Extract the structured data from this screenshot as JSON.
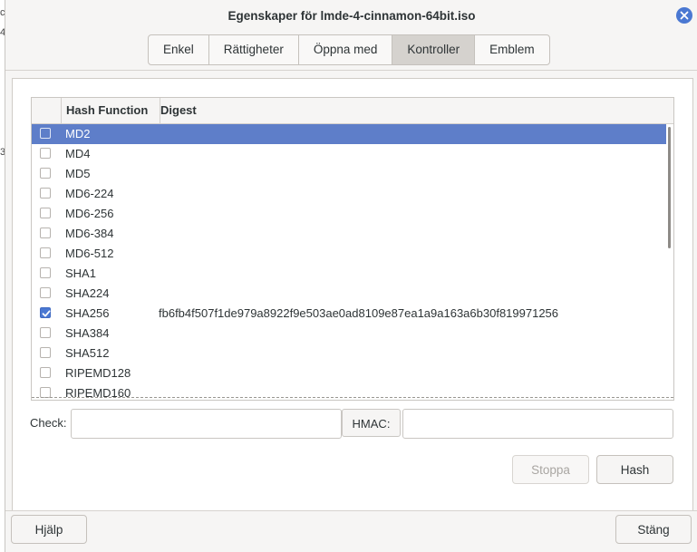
{
  "window": {
    "title": "Egenskaper för lmde-4-cinnamon-64bit.iso",
    "close_icon": "close-icon"
  },
  "background_fragments": [
    "cc",
    "4",
    "3"
  ],
  "tabs": [
    {
      "label": "Enkel",
      "active": false
    },
    {
      "label": "Rättigheter",
      "active": false
    },
    {
      "label": "Öppna med",
      "active": false
    },
    {
      "label": "Kontroller",
      "active": true
    },
    {
      "label": "Emblem",
      "active": false
    }
  ],
  "table": {
    "headers": {
      "hash_function": "Hash Function",
      "digest": "Digest"
    },
    "rows": [
      {
        "name": "MD2",
        "checked": false,
        "selected": true,
        "digest": ""
      },
      {
        "name": "MD4",
        "checked": false,
        "selected": false,
        "digest": ""
      },
      {
        "name": "MD5",
        "checked": false,
        "selected": false,
        "digest": ""
      },
      {
        "name": "MD6-224",
        "checked": false,
        "selected": false,
        "digest": ""
      },
      {
        "name": "MD6-256",
        "checked": false,
        "selected": false,
        "digest": ""
      },
      {
        "name": "MD6-384",
        "checked": false,
        "selected": false,
        "digest": ""
      },
      {
        "name": "MD6-512",
        "checked": false,
        "selected": false,
        "digest": ""
      },
      {
        "name": "SHA1",
        "checked": false,
        "selected": false,
        "digest": ""
      },
      {
        "name": "SHA224",
        "checked": false,
        "selected": false,
        "digest": ""
      },
      {
        "name": "SHA256",
        "checked": true,
        "selected": false,
        "digest": "fb6fb4f507f1de979a8922f9e503ae0ad8109e87ea1a9a163a6b30f819971256"
      },
      {
        "name": "SHA384",
        "checked": false,
        "selected": false,
        "digest": ""
      },
      {
        "name": "SHA512",
        "checked": false,
        "selected": false,
        "digest": ""
      },
      {
        "name": "RIPEMD128",
        "checked": false,
        "selected": false,
        "digest": ""
      },
      {
        "name": "RIPEMD160",
        "checked": false,
        "selected": false,
        "digest": ""
      }
    ]
  },
  "check": {
    "label": "Check:",
    "value": ""
  },
  "hmac": {
    "label": "HMAC:",
    "value": ""
  },
  "buttons": {
    "stop": "Stoppa",
    "hash": "Hash",
    "help": "Hjälp",
    "close": "Stäng"
  },
  "colors": {
    "accent": "#4a78d2",
    "selection": "#5e7ec9",
    "background": "#f6f5f4"
  }
}
